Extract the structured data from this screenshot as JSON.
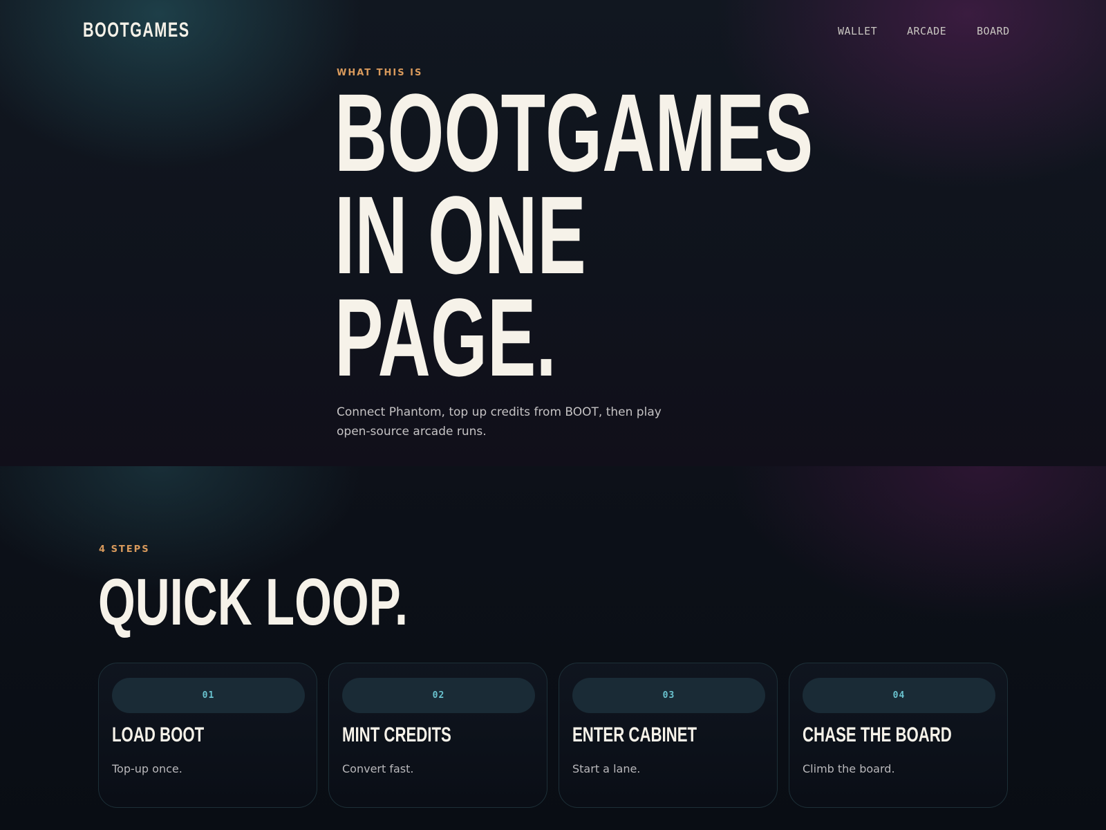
{
  "header": {
    "logo": "BOOTGAMES",
    "nav": [
      {
        "label": "WALLET"
      },
      {
        "label": "ARCADE"
      },
      {
        "label": "BOARD"
      }
    ]
  },
  "hero": {
    "eyebrow": "WHAT THIS IS",
    "title_lines": [
      "BOOTGAMES",
      "IN ONE",
      "PAGE."
    ],
    "description": "Connect Phantom, top up credits from BOOT, then play open-source arcade runs."
  },
  "steps": {
    "eyebrow": "4 STEPS",
    "title": "QUICK LOOP.",
    "cards": [
      {
        "number": "01",
        "title": "LOAD BOOT",
        "description": "Top-up once."
      },
      {
        "number": "02",
        "title": "MINT CREDITS",
        "description": "Convert fast."
      },
      {
        "number": "03",
        "title": "ENTER CABINET",
        "description": "Start a lane."
      },
      {
        "number": "04",
        "title": "CHASE THE BOARD",
        "description": "Climb the board."
      }
    ]
  },
  "colors": {
    "accent_orange": "#d99a5c",
    "accent_cyan": "#6ac3cf",
    "text_cream": "#f6f2e9",
    "background": "#0b1018"
  }
}
